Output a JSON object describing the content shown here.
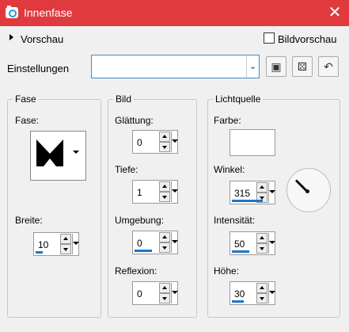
{
  "window": {
    "title": "Innenfase",
    "close_icon": "close-icon"
  },
  "preview": {
    "label": "Vorschau",
    "checkbox_label": "Bildvorschau",
    "checked": false
  },
  "settings": {
    "label": "Einstellungen",
    "combo_value": ""
  },
  "groups": {
    "fase": {
      "title": "Fase",
      "preset_label": "Fase:",
      "breite_label": "Breite:",
      "breite_value": "10",
      "breite_level": 0.2
    },
    "bild": {
      "title": "Bild",
      "glattung_label": "Glättung:",
      "glattung_value": "0",
      "glattung_level": 0,
      "tiefe_label": "Tiefe:",
      "tiefe_value": "1",
      "tiefe_level": 0,
      "umgebung_label": "Umgebung:",
      "umgebung_value": "0",
      "umgebung_level": 0.5,
      "reflexion_label": "Reflexion:",
      "reflexion_value": "0",
      "reflexion_level": 0
    },
    "lichtquelle": {
      "title": "Lichtquelle",
      "farbe_label": "Farbe:",
      "farbe_color": "#ffffff",
      "winkel_label": "Winkel:",
      "winkel_value": "315",
      "winkel_level": 0.875,
      "intensitat_label": "Intensität:",
      "intensitat_value": "50",
      "intensitat_level": 0.5,
      "hohe_label": "Höhe:",
      "hohe_value": "30",
      "hohe_level": 0.33
    }
  },
  "colors": {
    "titlebar": "#e03a3e",
    "accent": "#1d75c9"
  }
}
